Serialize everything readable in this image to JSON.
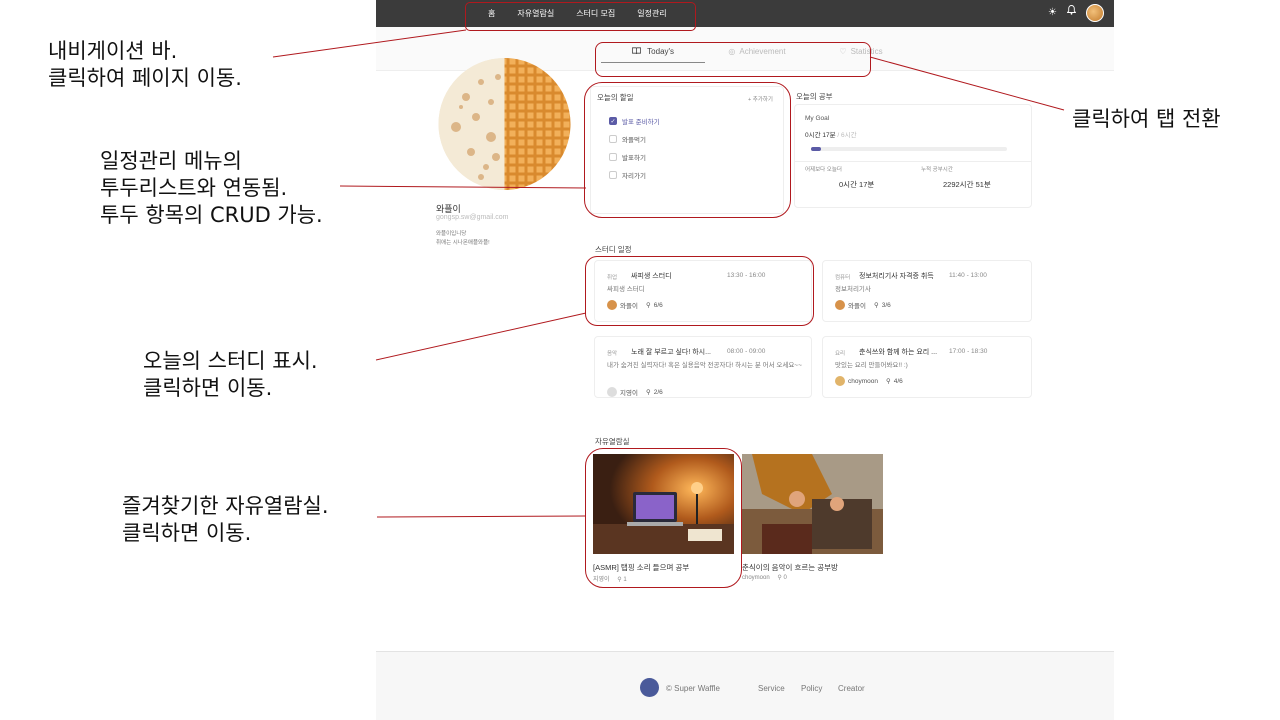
{
  "nav": {
    "links": [
      "홈",
      "자유열람실",
      "스터디 모집",
      "일정관리"
    ]
  },
  "tabs": [
    {
      "label": "Today's",
      "active": true
    },
    {
      "label": "Achievement",
      "active": false
    },
    {
      "label": "Statistics",
      "active": false
    }
  ],
  "profile": {
    "name": "와플이",
    "email": "gongsp.sw@gmail.com",
    "bio_line1": "와플이입니당",
    "bio_line2": "취애는 시나몬애플와플!"
  },
  "todo": {
    "title": "오늘의 할일",
    "add_label": "+ 추가하기",
    "items": [
      {
        "label": "발표 준비하기",
        "checked": true
      },
      {
        "label": "와플먹기",
        "checked": false
      },
      {
        "label": "발표하기",
        "checked": false
      },
      {
        "label": "자리가기",
        "checked": false
      }
    ]
  },
  "study_today": {
    "title": "오늘의 공부",
    "goal_label": "My Goal",
    "goal_value": "0시간 17분",
    "goal_target": "/ 6시간",
    "goal_progress": 0.05,
    "vs_yesterday_label": "어제보다 오늘더",
    "vs_yesterday_value": "0시간 17분",
    "total_label": "누적 공부시간",
    "total_value": "2292시간 51분"
  },
  "schedule": {
    "title": "스터디 일정",
    "items": [
      {
        "category": "취업",
        "name": "싸피생 스터디",
        "time": "13:30 - 16:00",
        "desc": "싸피생 스터디",
        "host": "와플이",
        "count": "6/6"
      },
      {
        "category": "컴퓨터",
        "name": "정보처리기사 자격증 취득",
        "time": "11:40 - 13:00",
        "desc": "정보처리기사",
        "host": "와플이",
        "count": "3/6"
      },
      {
        "category": "음악",
        "name": "노래 잘 부르고 싶다! 하시...",
        "time": "08:00 - 09:00",
        "desc": "내가 숨겨진 실력자다! 혹은 실용음악 전공자다! 하시는 분 어서 오세요~~",
        "host": "지영이",
        "count": "2/6"
      },
      {
        "category": "요리",
        "name": "춘식쓰와 함께 하는 요리 ...",
        "time": "17:00 - 18:30",
        "desc": "맛있는 요리 만들어봐요!! :)",
        "host": "choymoon",
        "count": "4/6"
      }
    ]
  },
  "rooms": {
    "title": "자유열람실",
    "items": [
      {
        "title": "[ASMR] 탭핑 소리 들으며 공부",
        "owner": "지영이",
        "count": "1"
      },
      {
        "title": "춘식이의 음악이 흐르는 공부방",
        "owner": "choymoon",
        "count": "0"
      }
    ]
  },
  "footer": {
    "copyright": "© Super Waffle",
    "links": [
      "Service",
      "Policy",
      "Creator"
    ]
  },
  "annotations": {
    "nav_note": [
      "내비게이션 바.",
      "클릭하여 페이지 이동."
    ],
    "tab_note": [
      "클릭하여 탭 전환"
    ],
    "todo_note": [
      "일정관리 메뉴의",
      "투두리스트와 연동됨.",
      "투두 항목의 CRUD 가능."
    ],
    "study_note": [
      "오늘의 스터디 표시.",
      "클릭하면 이동."
    ],
    "room_note": [
      "즐겨찾기한 자유열람실.",
      "클릭하면 이동."
    ]
  },
  "colors": {
    "nav_bg": "#3b3b3b",
    "accent": "#5b5ba6",
    "annotation": "#b0191e"
  }
}
